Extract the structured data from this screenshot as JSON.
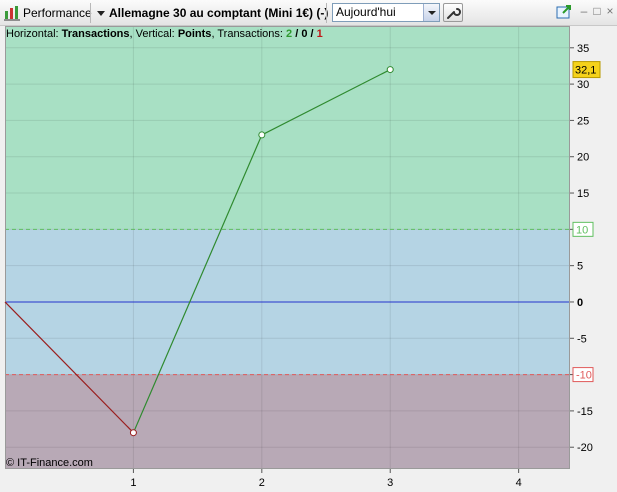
{
  "toolbar": {
    "performance_label": "Performance",
    "instrument_title": "Allemagne 30 au comptant (Mini 1€) (-)",
    "period_value": "Aujourd'hui"
  },
  "info": {
    "horizontal_label": "Horizontal:",
    "horizontal_value": "Transactions",
    "vertical_label": ", Vertical:",
    "vertical_value": "Points",
    "transactions_label": ", Transactions:",
    "tx_win": "2",
    "tx_sep1": " / ",
    "tx_even": "0",
    "tx_sep2": " / ",
    "tx_loss": "1"
  },
  "copyright": "© IT-Finance.com",
  "colors": {
    "zone_profit": "#a8e0c4",
    "zone_neutral": "#b5d4e4",
    "zone_loss": "#b8a9b6",
    "line_gain": "#2f8a2f",
    "line_loss": "#9a1e1e",
    "zero_line": "#2233cc",
    "upper_threshold": "#5fbf5f",
    "lower_threshold": "#e05a5a",
    "last_value_badge": "#f5d21a",
    "win_count": "#2f9a2f",
    "loss_count": "#c01818"
  },
  "chart_data": {
    "type": "line",
    "x": [
      0,
      1,
      2,
      3
    ],
    "y": [
      0,
      -18,
      23,
      32
    ],
    "xlim": [
      0,
      4.4
    ],
    "ylim": [
      -23,
      38
    ],
    "x_ticks": [
      1,
      2,
      3,
      4
    ],
    "y_ticks": [
      35,
      30,
      25,
      20,
      15,
      10,
      5,
      0,
      -5,
      -10,
      -15,
      -20
    ],
    "upper_threshold": 10,
    "lower_threshold": -10,
    "last_value_label": "32,1",
    "grid": true
  }
}
